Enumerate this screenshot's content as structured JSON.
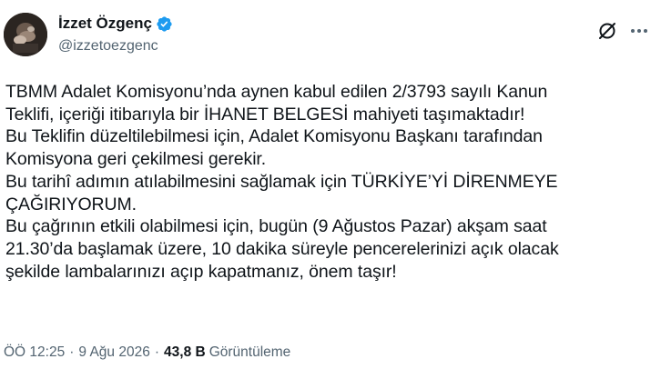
{
  "author": {
    "name": "İzzet Özgenç",
    "handle": "@izzetoezgenc",
    "verified_color": "#1d9bf0"
  },
  "icons": {
    "grok": "grok-icon",
    "more": "more-horizontal-icon",
    "verified": "verified-badge-icon"
  },
  "tweet": {
    "lines": [
      "TBMM Adalet Komisyonu’nda aynen kabul edilen 2/3793 sayılı Kanun",
      "Teklifi, içeriği itibarıyla bir İHANET BELGESİ mahiyeti taşımaktadır!",
      "Bu Teklifin düzeltilebilmesi için, Adalet Komisyonu Başkanı tarafından",
      "Komisyona geri çekilmesi gerekir.",
      "Bu tarihî adımın atılabilmesini sağlamak için TÜRKİYE’Yİ DİRENMEYE",
      "ÇAĞIRIYORUM.",
      "Bu çağrının etkili olabilmesi için, bugün (9 Ağustos Pazar) akşam saat",
      "21.30’da başlamak üzere, 10 dakika süreyle pencerelerinizi açık olacak",
      "şekilde lambalarınızı açıp kapatmanız, önem taşır!"
    ]
  },
  "meta": {
    "time": "ÖÖ 12:25",
    "separator": "·",
    "date": "9 Ağu 2026",
    "views_count": "43,8 B",
    "views_label": "Görüntüleme"
  }
}
